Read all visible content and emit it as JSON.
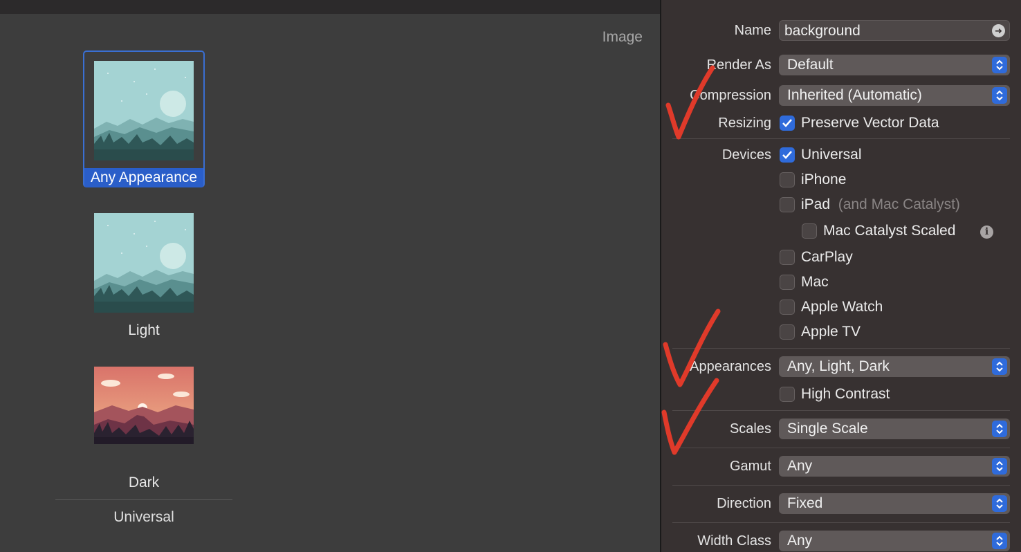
{
  "asset_set": {
    "type_label": "Image",
    "slots": [
      {
        "caption": "Any Appearance",
        "selected": true
      },
      {
        "caption": "Light",
        "selected": false
      },
      {
        "caption": "Dark",
        "selected": false
      }
    ],
    "group_label": "Universal"
  },
  "inspector": {
    "name": {
      "label": "Name",
      "value": "background"
    },
    "render_as": {
      "label": "Render As",
      "value": "Default"
    },
    "compression": {
      "label": "Compression",
      "value": "Inherited (Automatic)"
    },
    "resizing": {
      "label": "Resizing",
      "option": "Preserve Vector Data",
      "checked": true
    },
    "devices": {
      "label": "Devices",
      "options": [
        {
          "label": "Universal",
          "checked": true
        },
        {
          "label": "iPhone",
          "checked": false
        },
        {
          "label": "iPad",
          "note": "(and Mac Catalyst)",
          "checked": false
        },
        {
          "label": "Mac Catalyst Scaled",
          "checked": false
        },
        {
          "label": "CarPlay",
          "checked": false
        },
        {
          "label": "Mac",
          "checked": false
        },
        {
          "label": "Apple Watch",
          "checked": false
        },
        {
          "label": "Apple TV",
          "checked": false
        }
      ]
    },
    "appearances": {
      "label": "Appearances",
      "value": "Any, Light, Dark",
      "high_contrast": {
        "label": "High Contrast",
        "checked": false
      }
    },
    "scales": {
      "label": "Scales",
      "value": "Single Scale"
    },
    "gamut": {
      "label": "Gamut",
      "value": "Any"
    },
    "direction": {
      "label": "Direction",
      "value": "Fixed"
    },
    "width_class": {
      "label": "Width Class",
      "value": "Any"
    }
  },
  "colors": {
    "accent": "#2f6bdb",
    "selection": "#2a5ec9",
    "annotation": "#e03a2a"
  },
  "icons": {
    "name_go": "arrow-right-circle-icon",
    "popup": "up-down-chevron-icon",
    "checkbox": "checkmark-icon",
    "info": "info-circle-icon"
  }
}
